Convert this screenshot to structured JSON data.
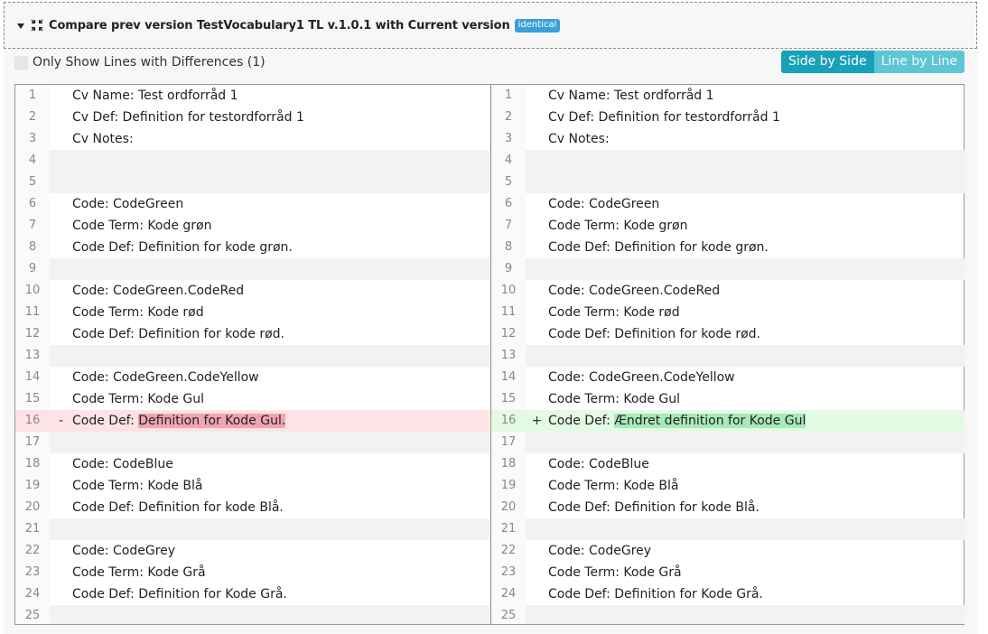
{
  "header": {
    "title": "Compare prev version TestVocabulary1 TL v.1.0.1 with Current version",
    "badge": "identical"
  },
  "controls": {
    "only_diff_label": "Only Show Lines with Differences (1)",
    "view_side_by_side": "Side by Side",
    "view_line_by_line": "Line by Line"
  },
  "icons": {
    "expand": "caret-down-icon",
    "compress": "compress-arrows-icon"
  },
  "colors": {
    "badge": "#3a9fd8",
    "toggle_active": "#17a2b8",
    "toggle_inactive": "#5dc6d6",
    "removed_line": "#fde3e5",
    "removed_highlight": "#f3a5ae",
    "added_line": "#e3fbe3",
    "added_highlight": "#a8eab8"
  },
  "left": [
    {
      "n": "1",
      "text": "Cv Name: Test ordforråd 1"
    },
    {
      "n": "2",
      "text": "Cv Def: Definition for testordforråd 1"
    },
    {
      "n": "3",
      "text": "Cv Notes:"
    },
    {
      "n": "4",
      "text": ""
    },
    {
      "n": "5",
      "text": ""
    },
    {
      "n": "6",
      "text": "Code: CodeGreen"
    },
    {
      "n": "7",
      "text": "Code Term: Kode grøn"
    },
    {
      "n": "8",
      "text": "Code Def: Definition for kode grøn."
    },
    {
      "n": "9",
      "text": ""
    },
    {
      "n": "10",
      "text": "Code: CodeGreen.CodeRed"
    },
    {
      "n": "11",
      "text": "Code Term: Kode rød"
    },
    {
      "n": "12",
      "text": "Code Def: Definition for kode rød."
    },
    {
      "n": "13",
      "text": ""
    },
    {
      "n": "14",
      "text": "Code: CodeGreen.CodeYellow"
    },
    {
      "n": "15",
      "text": "Code Term: Kode Gul"
    },
    {
      "n": "16",
      "text": "",
      "marker": "-",
      "prefix": "Code Def: ",
      "changed": "Definition for Kode Gul.",
      "type": "removed"
    },
    {
      "n": "17",
      "text": ""
    },
    {
      "n": "18",
      "text": "Code: CodeBlue"
    },
    {
      "n": "19",
      "text": "Code Term: Kode Blå"
    },
    {
      "n": "20",
      "text": "Code Def: Definition for kode Blå."
    },
    {
      "n": "21",
      "text": ""
    },
    {
      "n": "22",
      "text": "Code: CodeGrey"
    },
    {
      "n": "23",
      "text": "Code Term: Kode Grå"
    },
    {
      "n": "24",
      "text": "Code Def: Definition for Kode Grå."
    },
    {
      "n": "25",
      "text": ""
    }
  ],
  "right": [
    {
      "n": "1",
      "text": "Cv Name: Test ordforråd 1"
    },
    {
      "n": "2",
      "text": "Cv Def: Definition for testordforråd 1"
    },
    {
      "n": "3",
      "text": "Cv Notes:"
    },
    {
      "n": "4",
      "text": ""
    },
    {
      "n": "5",
      "text": ""
    },
    {
      "n": "6",
      "text": "Code: CodeGreen"
    },
    {
      "n": "7",
      "text": "Code Term: Kode grøn"
    },
    {
      "n": "8",
      "text": "Code Def: Definition for kode grøn."
    },
    {
      "n": "9",
      "text": ""
    },
    {
      "n": "10",
      "text": "Code: CodeGreen.CodeRed"
    },
    {
      "n": "11",
      "text": "Code Term: Kode rød"
    },
    {
      "n": "12",
      "text": "Code Def: Definition for kode rød."
    },
    {
      "n": "13",
      "text": ""
    },
    {
      "n": "14",
      "text": "Code: CodeGreen.CodeYellow"
    },
    {
      "n": "15",
      "text": "Code Term: Kode Gul"
    },
    {
      "n": "16",
      "text": "",
      "marker": "+",
      "prefix": "Code Def: ",
      "changed": "Ændret definition for Kode Gul",
      "type": "added"
    },
    {
      "n": "17",
      "text": ""
    },
    {
      "n": "18",
      "text": "Code: CodeBlue"
    },
    {
      "n": "19",
      "text": "Code Term: Kode Blå"
    },
    {
      "n": "20",
      "text": "Code Def: Definition for kode Blå."
    },
    {
      "n": "21",
      "text": ""
    },
    {
      "n": "22",
      "text": "Code: CodeGrey"
    },
    {
      "n": "23",
      "text": "Code Term: Kode Grå"
    },
    {
      "n": "24",
      "text": "Code Def: Definition for Kode Grå."
    },
    {
      "n": "25",
      "text": ""
    }
  ]
}
